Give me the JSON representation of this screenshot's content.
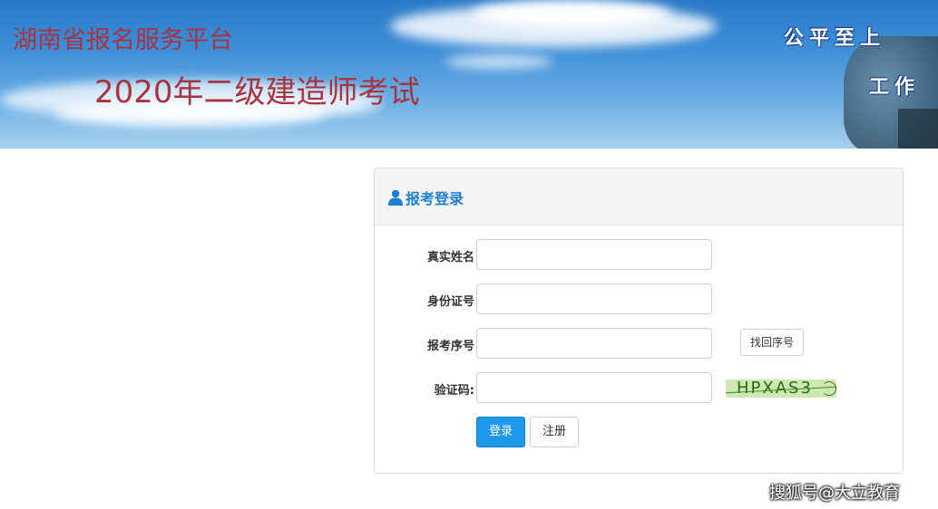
{
  "banner": {
    "platform_title": "湖南省报名服务平台",
    "exam_title": "2020年二级建造师考试",
    "slogan_line1": "公平至上",
    "slogan_line2": "工作"
  },
  "login_panel": {
    "title": "报考登录",
    "icon": "user-icon",
    "fields": {
      "name_label": "真实姓名",
      "name_value": "",
      "id_label": "身份证号",
      "id_value": "",
      "serial_label": "报考序号",
      "serial_value": "",
      "captcha_label": "验证码:",
      "captcha_value": "",
      "captcha_image_text": "HPXAS3"
    },
    "buttons": {
      "find_serial": "找回序号",
      "login": "登录",
      "register": "注册"
    },
    "colors": {
      "accent": "#1e98ea",
      "title": "#1f7fd3"
    }
  },
  "watermark": "搜狐号@大立教育"
}
